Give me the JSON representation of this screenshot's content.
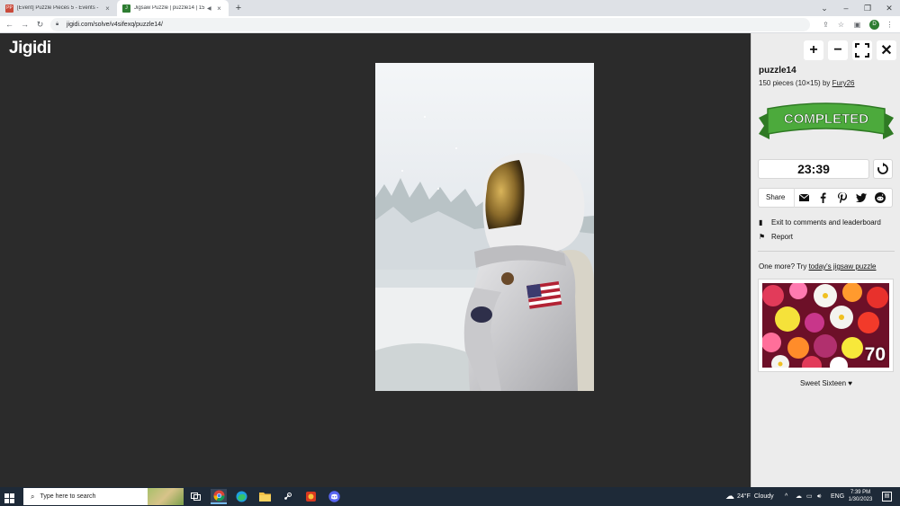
{
  "browser": {
    "tabs": [
      {
        "favicon": "PP",
        "title": "[Event] Puzzle Pieces 5 - Events -",
        "close": "×"
      },
      {
        "favicon": "J",
        "title": "Jigsaw Puzzle | puzzle14 | 15",
        "close": "×"
      }
    ],
    "new_tab": "+",
    "window_controls": {
      "minimize": "–",
      "restore": "❐",
      "close": "✕"
    },
    "url": "jigidi.com/solve/v4sifexq/puzzle14/",
    "profile_initial": "D"
  },
  "app": {
    "logo": "Jigidi",
    "puzzle": {
      "title": "puzzle14",
      "info_prefix": "150 pieces (10×15) by ",
      "author": "Fury26",
      "status_badge": "COMPLETED",
      "timer": "23:39"
    },
    "controls": {
      "zoom_in": "+",
      "zoom_out": "−",
      "close": "✕"
    },
    "share": {
      "label": "Share"
    },
    "links": {
      "exit": "Exit to comments and leaderboard",
      "report": "Report"
    },
    "suggestion": {
      "prefix": "One more? Try ",
      "link": "today's jigsaw puzzle",
      "count": "70",
      "caption": "Sweet Sixteen ♥"
    }
  },
  "taskbar": {
    "search_placeholder": "Type here to search",
    "weather_temp": "24°F",
    "weather_desc": "Cloudy",
    "language": "ENG",
    "time": "7:39 PM",
    "date": "1/30/2023"
  },
  "colors": {
    "stage_bg": "#2b2b2b",
    "panel_bg": "#ececec",
    "badge_green": "#4caa3c",
    "taskbar_bg": "#1e2a38"
  }
}
